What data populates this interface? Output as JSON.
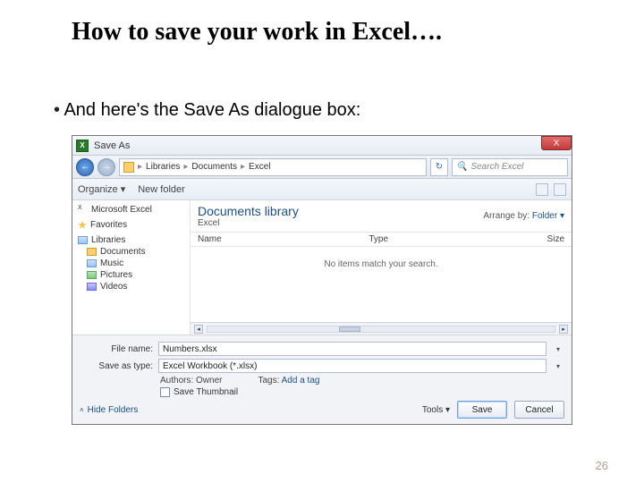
{
  "slide": {
    "title": "How to save your work in Excel….",
    "bullet": "And here's the Save As dialogue box:",
    "page_number": "26"
  },
  "dialog": {
    "title": "Save As",
    "close_glyph": "X",
    "nav": {
      "back_glyph": "←",
      "fwd_glyph": "→",
      "crumb1": "Libraries",
      "crumb2": "Documents",
      "crumb3": "Excel",
      "sep": "▸",
      "refresh_glyph": "↻",
      "search_placeholder": "Search Excel"
    },
    "toolbar": {
      "organize": "Organize ▾",
      "new_folder": "New folder"
    },
    "nav_pane": {
      "ms_excel": "Microsoft Excel",
      "favorites": "Favorites",
      "libraries": "Libraries",
      "documents": "Documents",
      "music": "Music",
      "pictures": "Pictures",
      "videos": "Videos"
    },
    "main": {
      "lib_title": "Documents library",
      "lib_sub": "Excel",
      "arrange_label": "Arrange by:",
      "arrange_value": "Folder ▾",
      "col_name": "Name",
      "col_type": "Type",
      "col_size": "Size",
      "empty_msg": "No items match your search."
    },
    "form": {
      "file_name_label": "File name:",
      "file_name_value": "Numbers.xlsx",
      "save_type_label": "Save as type:",
      "save_type_value": "Excel Workbook (*.xlsx)",
      "authors_label": "Authors:",
      "authors_value": "Owner",
      "tags_label": "Tags:",
      "tags_value": "Add a tag",
      "save_thumbnail": "Save Thumbnail",
      "hide_folders": "Hide Folders",
      "tools": "Tools ▾",
      "save_btn": "Save",
      "cancel_btn": "Cancel"
    }
  }
}
